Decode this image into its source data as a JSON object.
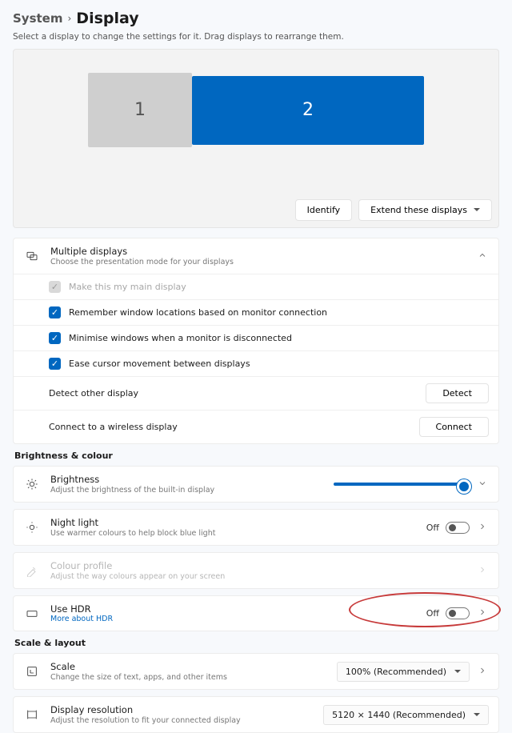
{
  "breadcrumb": {
    "parent": "System",
    "current": "Display"
  },
  "subtitle": "Select a display to change the settings for it. Drag displays to rearrange them.",
  "monitors": {
    "one": "1",
    "two": "2"
  },
  "arrange": {
    "identify": "Identify",
    "mode": "Extend these displays"
  },
  "multi": {
    "title": "Multiple displays",
    "desc": "Choose the presentation mode for your displays",
    "opts": {
      "main": "Make this my main display",
      "remember": "Remember window locations based on monitor connection",
      "minimise": "Minimise windows when a monitor is disconnected",
      "ease": "Ease cursor movement between displays",
      "detect_label": "Detect other display",
      "detect_btn": "Detect",
      "connect_label": "Connect to a wireless display",
      "connect_btn": "Connect"
    }
  },
  "sections": {
    "bright": "Brightness & colour",
    "scale": "Scale & layout"
  },
  "brightness": {
    "title": "Brightness",
    "desc": "Adjust the brightness of the built-in display"
  },
  "night": {
    "title": "Night light",
    "desc": "Use warmer colours to help block blue light",
    "state": "Off"
  },
  "colour": {
    "title": "Colour profile",
    "desc": "Adjust the way colours appear on your screen"
  },
  "hdr": {
    "title": "Use HDR",
    "link": "More about HDR",
    "state": "Off"
  },
  "scale": {
    "title": "Scale",
    "desc": "Change the size of text, apps, and other items",
    "value": "100% (Recommended)"
  },
  "res": {
    "title": "Display resolution",
    "desc": "Adjust the resolution to fit your connected display",
    "value": "5120 × 1440 (Recommended)"
  }
}
